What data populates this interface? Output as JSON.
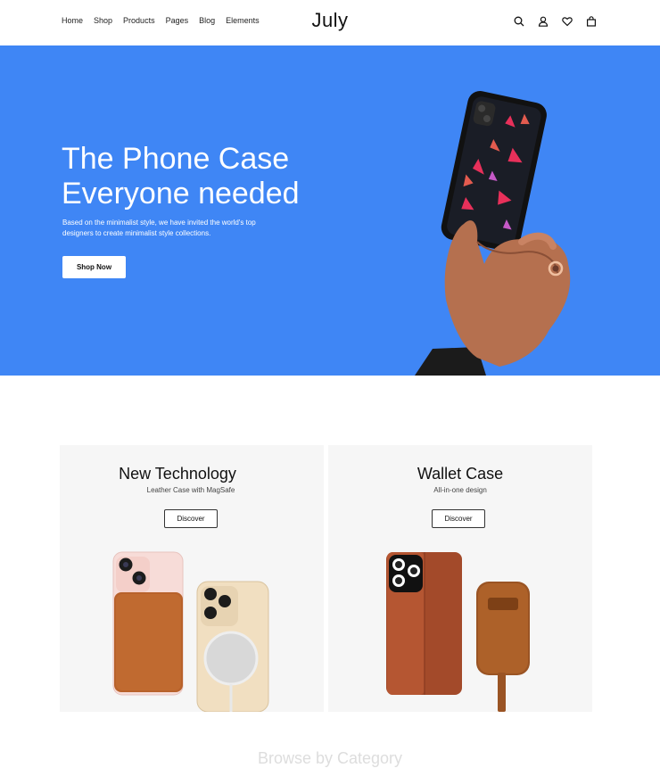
{
  "nav": {
    "items": [
      "Home",
      "Shop",
      "Products",
      "Pages",
      "Blog",
      "Elements"
    ]
  },
  "logo": "July",
  "header_icons": [
    "search-icon",
    "user-icon",
    "heart-icon",
    "bag-icon"
  ],
  "hero": {
    "title": "The Phone Case\nEveryone needed",
    "subtitle": "Based on the minimalist style, we have invited the world's top designers to create minimalist style collections.",
    "button": "Shop Now",
    "background": "#3f86f5"
  },
  "cards": [
    {
      "title": "New Technology",
      "subtitle": "Leather Case with MagSafe",
      "button": "Discover"
    },
    {
      "title": "Wallet Case",
      "subtitle": "All-in-one design",
      "button": "Discover"
    }
  ],
  "section_heading": "Browse by Category"
}
